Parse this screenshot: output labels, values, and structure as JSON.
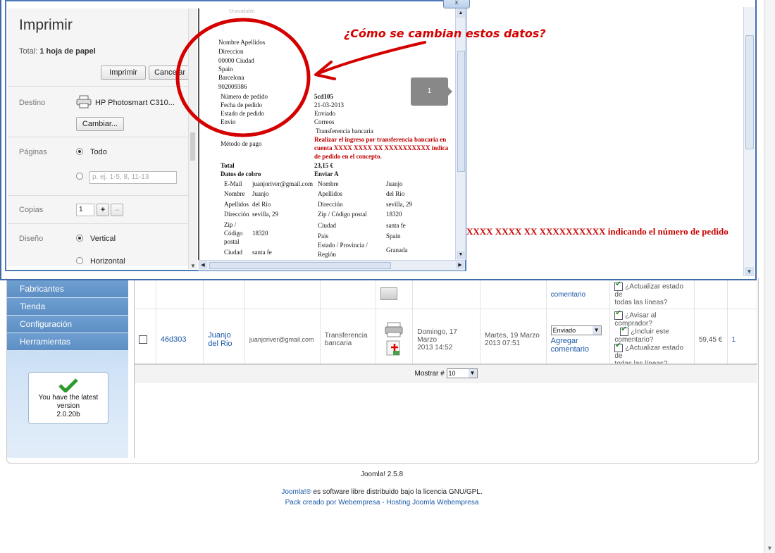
{
  "print_dialog": {
    "close_label": "x",
    "title": "Imprimir",
    "total_label": "Total:",
    "total_value": "1 hoja de papel",
    "print_button": "Imprimir",
    "cancel_button": "Cancelar",
    "destination_label": "Destino",
    "printer_name": "HP Photosmart C310...",
    "change_button": "Cambiar...",
    "pages_label": "Páginas",
    "pages_all": "Todo",
    "pages_placeholder": "p. ej. 1-5, 8, 11-13",
    "copies_label": "Copias",
    "copies_value": "1",
    "copies_plus": "+",
    "copies_minus": "–",
    "layout_label": "Diseño",
    "layout_vertical": "Vertical",
    "layout_horizontal": "Horizontal"
  },
  "preview": {
    "unavailable": "Unavailable",
    "address": [
      "Nombre Apellidos",
      "Direccion",
      "00000 Ciudad",
      "Spain",
      "Barcelona",
      "902009386"
    ],
    "order_rows": [
      {
        "label": "Número de pedido",
        "value": "5cd105"
      },
      {
        "label": "Fecha de pedido",
        "value": "21-03-2013"
      },
      {
        "label": "Estado de pedido",
        "value": "Enviado"
      },
      {
        "label": "Envio",
        "value": "Correos"
      }
    ],
    "transfer": "Transferencia bancaria",
    "payment_label": "Método de pago",
    "payment_note": [
      "Realizar el ingreso por transferencia bancaria en",
      "cuenta XXXX XXXX XX XXXXXXXXXX indica",
      "de pedido en el concepto."
    ],
    "total_label": "Total",
    "total_value": "23,15 €",
    "billing_heading": "Datos de cobro",
    "shipping_heading": "Enviar A",
    "billing": [
      {
        "k": "E-Mail",
        "v": "juanjoriver@gmail.com"
      },
      {
        "k": "Nombre",
        "v": "Juanjo"
      },
      {
        "k": "Apellidos",
        "v": "del Rio"
      },
      {
        "k": "Dirección",
        "v": "sevilla, 29"
      },
      {
        "k": "Zip /",
        "v": ""
      },
      {
        "k": "Código",
        "v": "18320"
      },
      {
        "k": "postal",
        "v": ""
      },
      {
        "k": "Ciudad",
        "v": "santa fe"
      }
    ],
    "shipping": [
      {
        "k": "Nombre",
        "v": "Juanjo"
      },
      {
        "k": "Apellidos",
        "v": "del Rio"
      },
      {
        "k": "Dirección",
        "v": "sevilla, 29"
      },
      {
        "k": "Zip / Código postal",
        "v": "18320"
      },
      {
        "k": "Ciudad",
        "v": "santa fe"
      },
      {
        "k": "Pais",
        "v": "Spain"
      },
      {
        "k": "Estado / Provincia /",
        "v": "Granada"
      },
      {
        "k": "Región",
        "v": ""
      }
    ],
    "page_badge": "1"
  },
  "annotation": {
    "question": "¿Cómo se cambian estos datos?",
    "color": "#d40000"
  },
  "background": {
    "red_note": "XXXX XXXX XX XXXXXXXXXX indicando el número de pedido",
    "menu": [
      "Fabricantes",
      "Tienda",
      "Configuración",
      "Herramientas"
    ],
    "version": {
      "line1": "You have the latest",
      "line2": "version",
      "line3": "2.0.20b"
    },
    "row1": {
      "notify1": "¿Actualizar estado de",
      "notify2": "todas las líneas?",
      "comment": "comentario"
    },
    "row2": {
      "order_id": "46d303",
      "customer1": "Juanjo",
      "customer2": "del Rio",
      "email": "juanjoriver@gmail.com",
      "payment1": "Transferencia",
      "payment2": "bancaria",
      "created1": "Domingo, 17 Marzo",
      "created2": "2013 14:52",
      "modified1": "Martes, 19 Marzo",
      "modified2": "2013 07:51",
      "status": "Enviado",
      "comment1": "Agregar",
      "comment2": "comentario",
      "notify": "¿Avisar al comprador?",
      "include1": "¿Incluir este",
      "include2": "comentario?",
      "update1": "¿Actualizar estado de",
      "update2": "todas las líneas?",
      "total": "59,45 €",
      "id": "1"
    },
    "pager_label": "Mostrar #",
    "pager_value": "10",
    "footer_version": "Joomla! 2.5.8",
    "footer_license_link": "Joomla!®",
    "footer_license_text": " es software libre distribuido bajo la licencia GNU/GPL.",
    "footer_pack": "Pack creado por ",
    "footer_pack_link": "Webempresa",
    "footer_sep": " - ",
    "footer_hosting": "Hosting Joomla Webempresa"
  }
}
